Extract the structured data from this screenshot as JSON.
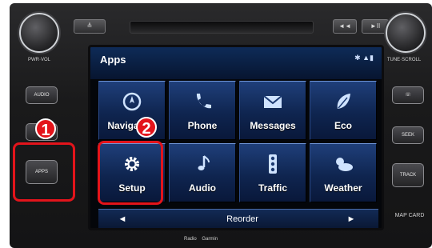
{
  "head_unit": {
    "left_knob_label": "PWR·VOL",
    "right_knob_label": "TUNE·SCROLL",
    "top_left_button": "≜",
    "top_right_button_1": "◄◄",
    "top_right_button_2": "►II",
    "left_buttons": [
      "AUDIO",
      "MAP",
      "APPS"
    ],
    "right_buttons": [
      "☏",
      "SEEK",
      "TRACK"
    ],
    "bottom_right_button": "MAP CARD",
    "footer_labels": [
      "Radio",
      "Garmin"
    ]
  },
  "screen": {
    "title": "Apps",
    "status_icons": "✱ ▲▮",
    "tiles": [
      {
        "label": "Navigation",
        "icon": "navigation-icon"
      },
      {
        "label": "Phone",
        "icon": "phone-icon"
      },
      {
        "label": "Messages",
        "icon": "envelope-icon"
      },
      {
        "label": "Eco",
        "icon": "leaf-icon"
      },
      {
        "label": "Setup",
        "icon": "gear-icon"
      },
      {
        "label": "Audio",
        "icon": "music-note-icon"
      },
      {
        "label": "Traffic",
        "icon": "traffic-light-icon"
      },
      {
        "label": "Weather",
        "icon": "cloud-sun-icon"
      }
    ],
    "nav_prev": "◄",
    "reorder": "Reorder",
    "nav_next": "►"
  },
  "callouts": {
    "step1": "1",
    "step2": "2",
    "color": "#e3141b"
  }
}
